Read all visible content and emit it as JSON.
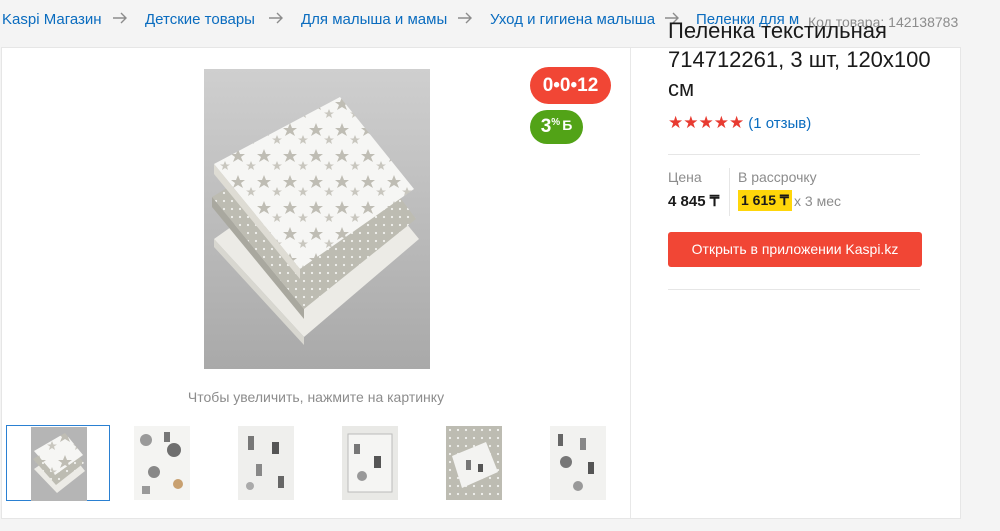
{
  "breadcrumb": {
    "items": [
      "Kaspi Магазин",
      "Детские товары",
      "Для малыша и мамы",
      "Уход и гигиена малыша",
      "Пеленки для м"
    ]
  },
  "product_code": "Код товара: 142138783",
  "badges": {
    "installment": "0•0•12",
    "bonus_percent": "3",
    "bonus_sign": "%",
    "bonus_currency": "Б"
  },
  "gallery": {
    "zoom_hint": "Чтобы увеличить, нажмите на картинку",
    "thumbnail_count": 6,
    "active_thumbnail": 1
  },
  "product": {
    "title": "Пеленка текстильная 714712261, 3 шт, 120x100 см",
    "stars": "★★★★★",
    "rating": 5,
    "reviews": "(1 отзыв)"
  },
  "pricing": {
    "price_label": "Цена",
    "price": "4 845 ₸",
    "installment_label": "В рассрочку",
    "installment_amount": "1 615 ₸",
    "installment_term": "x 3 мес"
  },
  "actions": {
    "open_in_app": "Открыть в приложении Kaspi.kz"
  },
  "colors": {
    "link": "#0a6cbf",
    "accent_red": "#f14635",
    "bonus_green": "#52a317",
    "highlight_yellow": "#ffd60a"
  }
}
